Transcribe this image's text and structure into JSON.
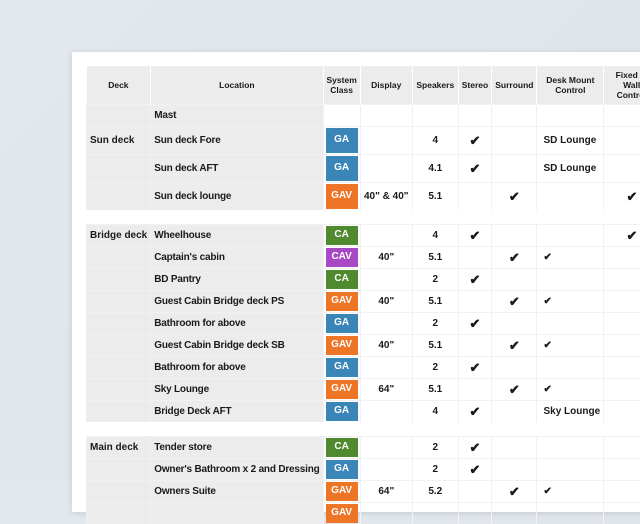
{
  "headers": [
    "Deck",
    "Location",
    "System Class",
    "Display",
    "Speakers",
    "Stereo",
    "Surround",
    "Desk Mount Control",
    "Fixed In Wall Control"
  ],
  "colors": {
    "GA": "#3b86b8",
    "GAV": "#ee7426",
    "CA": "#4f8a2e",
    "CAV": "#a848c4"
  },
  "check_mark": "✔",
  "rows": [
    {
      "deck": "",
      "location": "Mast",
      "system": "",
      "display": "",
      "speakers": "",
      "stereo": "",
      "surround": "",
      "desk": "",
      "wall": ""
    },
    {
      "deck": "Sun deck",
      "location": "Sun deck Fore",
      "system": "GA",
      "display": "",
      "speakers": "4",
      "stereo": "✔",
      "surround": "",
      "desk": "SD Lounge",
      "wall": "",
      "tall": true
    },
    {
      "deck": "",
      "location": "Sun deck AFT",
      "system": "GA",
      "display": "",
      "speakers": "4.1",
      "stereo": "✔",
      "surround": "",
      "desk": "SD Lounge",
      "wall": "",
      "tall": true
    },
    {
      "deck": "",
      "location": "Sun deck lounge",
      "system": "GAV",
      "display": "40\" & 40\"",
      "speakers": "5.1",
      "stereo": "",
      "surround": "✔",
      "desk": "",
      "wall": "✔",
      "tall": true
    },
    {
      "gap": true
    },
    {
      "deck": "Bridge deck",
      "location": "Wheelhouse",
      "system": "CA",
      "display": "",
      "speakers": "4",
      "stereo": "✔",
      "surround": "",
      "desk": "",
      "wall": "✔"
    },
    {
      "deck": "",
      "location": "Captain's cabin",
      "system": "CAV",
      "display": "40\"",
      "speakers": "5.1",
      "stereo": "",
      "surround": "✔",
      "desk": "✔",
      "wall": ""
    },
    {
      "deck": "",
      "location": "BD Pantry",
      "system": "CA",
      "display": "",
      "speakers": "2",
      "stereo": "✔",
      "surround": "",
      "desk": "",
      "wall": ""
    },
    {
      "deck": "",
      "location": "Guest Cabin Bridge deck PS",
      "system": "GAV",
      "display": "40\"",
      "speakers": "5.1",
      "stereo": "",
      "surround": "✔",
      "desk": "✔",
      "wall": ""
    },
    {
      "deck": "",
      "location": "Bathroom for above",
      "system": "GA",
      "display": "",
      "speakers": "2",
      "stereo": "✔",
      "surround": "",
      "desk": "",
      "wall": ""
    },
    {
      "deck": "",
      "location": "Guest Cabin Bridge deck SB",
      "system": "GAV",
      "display": "40\"",
      "speakers": "5.1",
      "stereo": "",
      "surround": "✔",
      "desk": "✔",
      "wall": ""
    },
    {
      "deck": "",
      "location": "Bathroom for above",
      "system": "GA",
      "display": "",
      "speakers": "2",
      "stereo": "✔",
      "surround": "",
      "desk": "",
      "wall": ""
    },
    {
      "deck": "",
      "location": "Sky Lounge",
      "system": "GAV",
      "display": "64\"",
      "speakers": "5.1",
      "stereo": "",
      "surround": "✔",
      "desk": "✔",
      "wall": ""
    },
    {
      "deck": "",
      "location": "Bridge Deck AFT",
      "system": "GA",
      "display": "",
      "speakers": "4",
      "stereo": "✔",
      "surround": "",
      "desk": "Sky Lounge",
      "wall": ""
    },
    {
      "gap": true
    },
    {
      "deck": "Main deck",
      "location": "Tender store",
      "system": "CA",
      "display": "",
      "speakers": "2",
      "stereo": "✔",
      "surround": "",
      "desk": "",
      "wall": ""
    },
    {
      "deck": "",
      "location": "Owner's Bathroom x 2 and Dressing",
      "system": "GA",
      "display": "",
      "speakers": "2",
      "stereo": "✔",
      "surround": "",
      "desk": "",
      "wall": ""
    },
    {
      "deck": "",
      "location": "Owners Suite",
      "system": "GAV",
      "display": "64\"",
      "speakers": "5.2",
      "stereo": "",
      "surround": "✔",
      "desk": "✔",
      "wall": ""
    },
    {
      "deck": "",
      "location": "",
      "system": "GAV",
      "display": "",
      "speakers": "",
      "stereo": "",
      "surround": "",
      "desk": "",
      "wall": ""
    }
  ]
}
